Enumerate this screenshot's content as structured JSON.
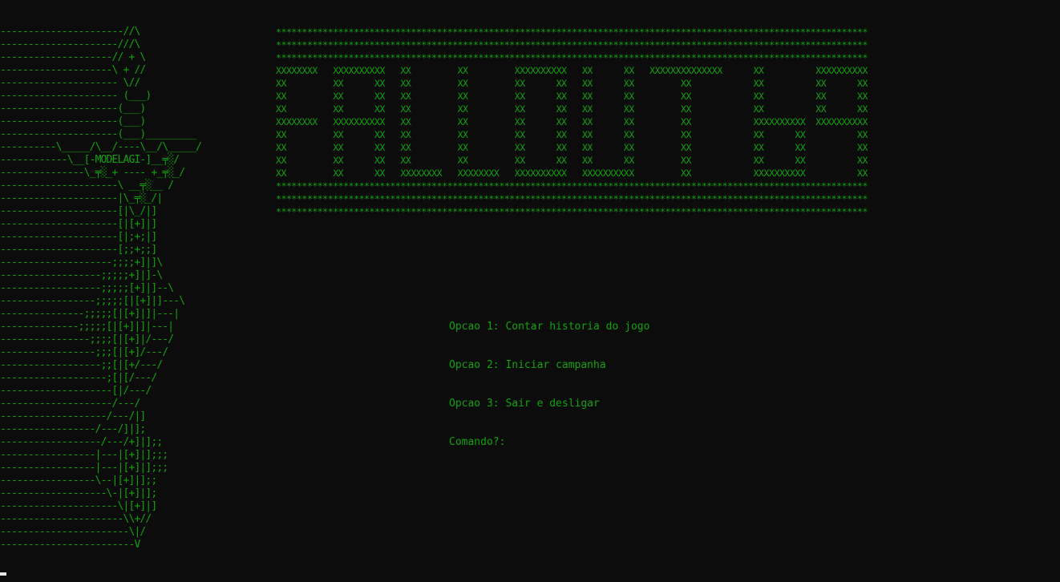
{
  "sword_art": [
    "----------------------//\\",
    "---------------------///\\",
    "--------------------// + \\",
    "--------------------\\ + //",
    "--------------------- \\//",
    "--------------------- (___)",
    "---------------------(___)",
    "---------------------(___)",
    "---------------------(___)_________",
    "----------\\_____/\\__/----\\__/\\_____/",
    "------------\\__[-MODELAGI-]__╤░/",
    "---------------\\_╤░_+ ---- +_╤░_/",
    "---------------------\\ __╤░__ /",
    "---------------------|\\_╤░_/|",
    "---------------------[|\\_/|]",
    "---------------------[|[+]|]",
    "---------------------[|;+;|]",
    "---------------------[;;+;;]",
    "--------------------;;;;+]|]\\",
    "------------------;;;;;+]|]-\\",
    "------------------;;;;;[+]|]--\\",
    "-----------------;;;;;[|[+]|]---\\",
    "---------------;;;;;[|[+]|]|---|",
    "--------------;;;;;[|[+]|]|---|",
    "----------------;;;;[|[+]|/---/",
    "-----------------;;;[|[+]/---/",
    "------------------;;[|[+/---/",
    "-------------------;[|[/---/",
    "--------------------[|/---/",
    "--------------------/---/",
    "-------------------/---/|]",
    "-----------------/---/]|];",
    "------------------/---/+]|];;",
    "-----------------|---|[+]|];;;",
    "-----------------|---|[+]|];;;",
    "-----------------\\--|[+]|];;",
    "-------------------\\-|[+]|];",
    "---------------------\\|[+]|]",
    "----------------------\\\\+//",
    "-----------------------\\|/",
    "------------------------V"
  ],
  "banner_art": [
    "******************************************************************************************************************",
    "******************************************************************************************************************",
    "******************************************************************************************************************",
    "XXXXXXXX   XXXXXXXXXX   XX         XX         XXXXXXXXXX   XX      XX   XXXXXXXXXXXXXX      XX          XXXXXXXXXX",
    "XX         XX      XX   XX         XX         XX      XX   XX      XX         XX            XX          XX      XX",
    "XX         XX      XX   XX         XX         XX      XX   XX      XX         XX            XX          XX      XX",
    "XX         XX      XX   XX         XX         XX      XX   XX      XX         XX            XX          XX      XX",
    "XXXXXXXX   XXXXXXXXXX   XX         XX         XX      XX   XX      XX         XX            XXXXXXXXXX  XXXXXXXXXX",
    "XX         XX      XX   XX         XX         XX      XX   XX      XX         XX            XX      XX          XX",
    "XX         XX      XX   XX         XX         XX      XX   XX      XX         XX            XX      XX          XX",
    "XX         XX      XX   XX         XX         XX      XX   XX      XX         XX            XX      XX          XX",
    "XX         XX      XX   XXXXXXXX   XXXXXXXX   XXXXXXXXXX   XXXXXXXXXX         XX            XXXXXXXXXX          XX",
    "******************************************************************************************************************",
    "******************************************************************************************************************",
    "******************************************************************************************************************"
  ],
  "menu": {
    "option1": "Opcao 1: Contar historia do jogo",
    "option2": "Opcao 2: Iniciar campanha",
    "option3": "Opcao 3: Sair e desligar",
    "prompt": "Comando?:"
  },
  "colors": {
    "background": "#0c0c0c",
    "text": "#13a10e",
    "cursor": "#e6e6e6"
  }
}
